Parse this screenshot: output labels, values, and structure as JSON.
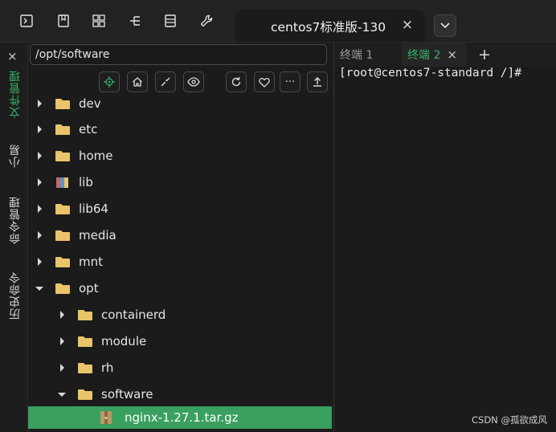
{
  "toolbar": {
    "icons": [
      "terminal-icon",
      "bookmark-icon",
      "layout-icon",
      "network-icon",
      "list-icon",
      "wrench-icon"
    ]
  },
  "session": {
    "title": "centos7标准版-130",
    "close_glyph": "×"
  },
  "left_rail": {
    "close_glyph": "×",
    "items": [
      {
        "label": "文件管理",
        "active": true
      },
      {
        "label": "小易",
        "active": false
      },
      {
        "label": "命令管理",
        "active": false
      },
      {
        "label": "历史命令",
        "active": false
      }
    ]
  },
  "file_panel": {
    "path": "/opt/software",
    "tools": [
      "locate-icon",
      "home-icon",
      "collapse-icon",
      "eye-icon",
      "refresh-icon",
      "heart-icon",
      "more-icon",
      "upload-icon"
    ],
    "more_glyph": "···",
    "tree": [
      {
        "name": "dev",
        "expanded": false
      },
      {
        "name": "etc",
        "expanded": false
      },
      {
        "name": "home",
        "expanded": false
      },
      {
        "name": "lib",
        "expanded": false
      },
      {
        "name": "lib64",
        "expanded": false
      },
      {
        "name": "media",
        "expanded": false
      },
      {
        "name": "mnt",
        "expanded": false
      },
      {
        "name": "opt",
        "expanded": true
      },
      {
        "name": "containerd",
        "expanded": false
      },
      {
        "name": "module",
        "expanded": false
      },
      {
        "name": "rh",
        "expanded": false
      },
      {
        "name": "software",
        "expanded": true
      },
      {
        "name": "nginx-1.27.1.tar.gz",
        "selected": true
      }
    ]
  },
  "terminal": {
    "tabs": [
      {
        "label": "终端 1",
        "active": false
      },
      {
        "label": "终端 2",
        "active": true
      }
    ],
    "add_glyph": "+",
    "tab_close_glyph": "×",
    "prompt": "[root@centos7-standard /]#"
  },
  "watermark": "CSDN @孤欲成风",
  "colors": {
    "accent_green": "#34b567",
    "selected_row": "#3aa05f",
    "folder_yellow": "#e9c46a",
    "background": "#1b1b1b"
  }
}
